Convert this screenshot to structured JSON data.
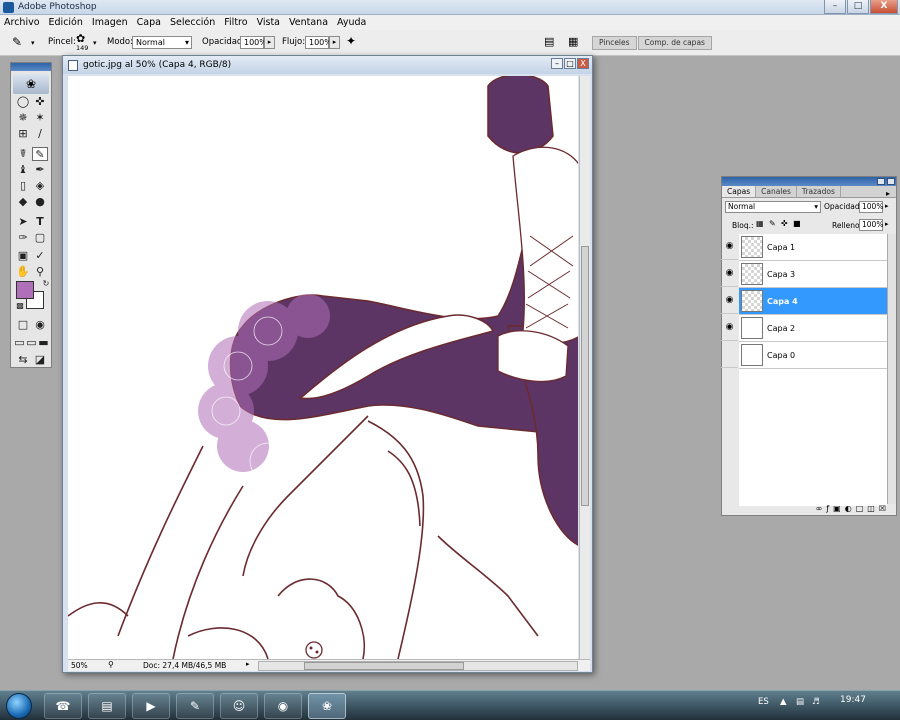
{
  "app": {
    "title": "Adobe Photoshop"
  },
  "window_controls": {
    "minimize": "–",
    "maximize": "□",
    "close": "X"
  },
  "menu": [
    "Archivo",
    "Edición",
    "Imagen",
    "Capa",
    "Selección",
    "Filtro",
    "Vista",
    "Ventana",
    "Ayuda"
  ],
  "options_bar": {
    "brush_label": "Pincel:",
    "brush_size": "149",
    "mode_label": "Modo:",
    "mode_value": "Normal",
    "opacity_label": "Opacidad:",
    "opacity_value": "100%",
    "flow_label": "Flujo:",
    "flow_value": "100%"
  },
  "panel_tabs": [
    "Pinceles",
    "Comp. de capas"
  ],
  "document": {
    "title": "gotic.jpg al 50% (Capa 4, RGB/8)",
    "zoom": "50%",
    "doc_info": "Doc: 27,4 MB/46,5 MB"
  },
  "colors": {
    "foreground": "#b06fb9",
    "background": "#ffffff",
    "dress": "#5c3565",
    "outline": "#6b2a2e",
    "selection": "#3399ff"
  },
  "layers_panel": {
    "tabs": [
      "Capas",
      "Canales",
      "Trazados"
    ],
    "blend_mode": "Normal",
    "opacity_label": "Opacidad:",
    "opacity_value": "100%",
    "lock_label": "Bloq.:",
    "fill_label": "Relleno:",
    "fill_value": "100%",
    "layers": [
      {
        "name": "Capa 1",
        "visible": true,
        "selected": false
      },
      {
        "name": "Capa 3",
        "visible": true,
        "selected": false
      },
      {
        "name": "Capa 4",
        "visible": true,
        "selected": true
      },
      {
        "name": "Capa 2",
        "visible": true,
        "selected": false
      },
      {
        "name": "Capa 0",
        "visible": false,
        "selected": false
      }
    ]
  },
  "taskbar": {
    "language": "ES",
    "time": "19:47"
  }
}
